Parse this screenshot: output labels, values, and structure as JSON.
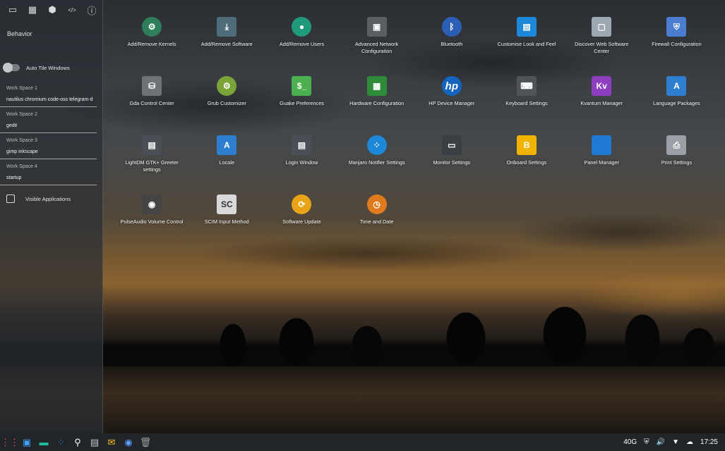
{
  "sidebar": {
    "tabs": [
      {
        "name": "monitor-icon",
        "glyph": "▭"
      },
      {
        "name": "grid-icon",
        "glyph": "▦"
      },
      {
        "name": "hexagon-icon",
        "glyph": "⬢"
      },
      {
        "name": "code-icon",
        "glyph": "</>"
      },
      {
        "name": "info-icon",
        "glyph": "ⓘ"
      }
    ],
    "heading": "Behavior",
    "auto_tile_label": "Auto Tile Windows",
    "workspaces": [
      {
        "label": "Work Space 1",
        "value": "nautilus chromium code-oss telegram-d"
      },
      {
        "label": "Work Space 2",
        "value": "gedit"
      },
      {
        "label": "Work Space 3",
        "value": "gimp inkscape"
      },
      {
        "label": "Work Space 4",
        "value": "startup"
      }
    ],
    "visible_apps_label": "Visible Applications"
  },
  "apps": [
    {
      "label": "Add/Remove Kernels",
      "icon": "gear-wrench-icon",
      "bg": "#2e7d5b",
      "glyph": "⚙"
    },
    {
      "label": "Add/Remove Software",
      "icon": "download-box-icon",
      "bg": "#4f6c7a",
      "glyph": "⤓"
    },
    {
      "label": "Add/Remove Users",
      "icon": "user-icon",
      "bg": "#1f9a7a",
      "glyph": "●"
    },
    {
      "label": "Advanced Network Configuration",
      "icon": "network-port-icon",
      "bg": "#5b5e62",
      "glyph": "▣"
    },
    {
      "label": "Bluetooth",
      "icon": "bluetooth-icon",
      "bg": "#2b5fb6",
      "glyph": "ᛒ"
    },
    {
      "label": "Customise Look and Feel",
      "icon": "display-settings-icon",
      "bg": "#1e88d8",
      "glyph": "▤"
    },
    {
      "label": "Discover Web Software Center",
      "icon": "store-bag-icon",
      "bg": "#9ea8b0",
      "glyph": "▢"
    },
    {
      "label": "Firewall Configuration",
      "icon": "shield-icon",
      "bg": "#4a7ccf",
      "glyph": "⛨"
    },
    {
      "label": "Gda Control Center",
      "icon": "database-icon",
      "bg": "#6f7378",
      "glyph": "⛁"
    },
    {
      "label": "Grub Customizer",
      "icon": "grub-gear-icon",
      "bg": "#7aa43a",
      "glyph": "⚙"
    },
    {
      "label": "Guake Preferences",
      "icon": "terminal-icon",
      "bg": "#4caf50",
      "glyph": "$_"
    },
    {
      "label": "Hardware Configuration",
      "icon": "circuit-board-icon",
      "bg": "#2e8b3a",
      "glyph": "▦"
    },
    {
      "label": "HP Device Manager",
      "icon": "hp-logo-icon",
      "bg": "#1565c0",
      "glyph": "hp"
    },
    {
      "label": "Keyboard Settings",
      "icon": "keyboard-icon",
      "bg": "#505459",
      "glyph": "⌨"
    },
    {
      "label": "Kvantum Manager",
      "icon": "kvantum-icon",
      "bg": "#8e3fbf",
      "glyph": "Kv"
    },
    {
      "label": "Language Packages",
      "icon": "language-icon",
      "bg": "#2f7fd1",
      "glyph": "A"
    },
    {
      "label": "LightDM GTK+ Greeter settings",
      "icon": "login-panel-icon",
      "bg": "#4b4f55",
      "glyph": "▤"
    },
    {
      "label": "Locale",
      "icon": "locale-icon",
      "bg": "#2f7fd1",
      "glyph": "A"
    },
    {
      "label": "Login Window",
      "icon": "login-window-icon",
      "bg": "#4b4f55",
      "glyph": "▤"
    },
    {
      "label": "Manjaro Notifier Settings",
      "icon": "notifier-icon",
      "bg": "#1e88d8",
      "glyph": "⁘"
    },
    {
      "label": "Monitor Settings",
      "icon": "monitor-icon",
      "bg": "#3b3e42",
      "glyph": "▭"
    },
    {
      "label": "Onboard Settings",
      "icon": "onboard-keyboard-icon",
      "bg": "#f0b400",
      "glyph": "B"
    },
    {
      "label": "Panel Manager",
      "icon": "panel-icon",
      "bg": "#1f78d1",
      "glyph": ""
    },
    {
      "label": "Print Settings",
      "icon": "printer-icon",
      "bg": "#9aa0a6",
      "glyph": "⎙"
    },
    {
      "label": "PulseAudio Volume Control",
      "icon": "speaker-icon",
      "bg": "#444",
      "glyph": "◉"
    },
    {
      "label": "SCIM Input Method",
      "icon": "scim-icon",
      "bg": "#d9d9d9",
      "glyph": "SC"
    },
    {
      "label": "Software Update",
      "icon": "update-arrows-icon",
      "bg": "#e8a317",
      "glyph": "⟳"
    },
    {
      "label": "Time and Date",
      "icon": "clock-icon",
      "bg": "#e07a1f",
      "glyph": "◷"
    }
  ],
  "taskbar": {
    "items": [
      {
        "name": "app-menu-icon",
        "glyph": "⋮⋮",
        "color": "#ff4d4d"
      },
      {
        "name": "workspaces-icon",
        "glyph": "▣",
        "color": "#3ea0ff"
      },
      {
        "name": "show-desktop-icon",
        "glyph": "▬",
        "color": "#1bbc9b"
      },
      {
        "name": "notifier-icon",
        "glyph": "⁘",
        "color": "#1e88d8"
      },
      {
        "name": "search-icon",
        "glyph": "⚲",
        "color": "#ffffff"
      },
      {
        "name": "files-icon",
        "glyph": "▤",
        "color": "#c7cbd0"
      },
      {
        "name": "mail-icon",
        "glyph": "✉",
        "color": "#f5c518"
      },
      {
        "name": "browser-icon",
        "glyph": "◉",
        "color": "#5aa0ff"
      },
      {
        "name": "trash-icon",
        "glyph": "🗑",
        "color": "#9aa0a6"
      }
    ],
    "tray": {
      "storage": "40G",
      "time": "17:25"
    }
  }
}
